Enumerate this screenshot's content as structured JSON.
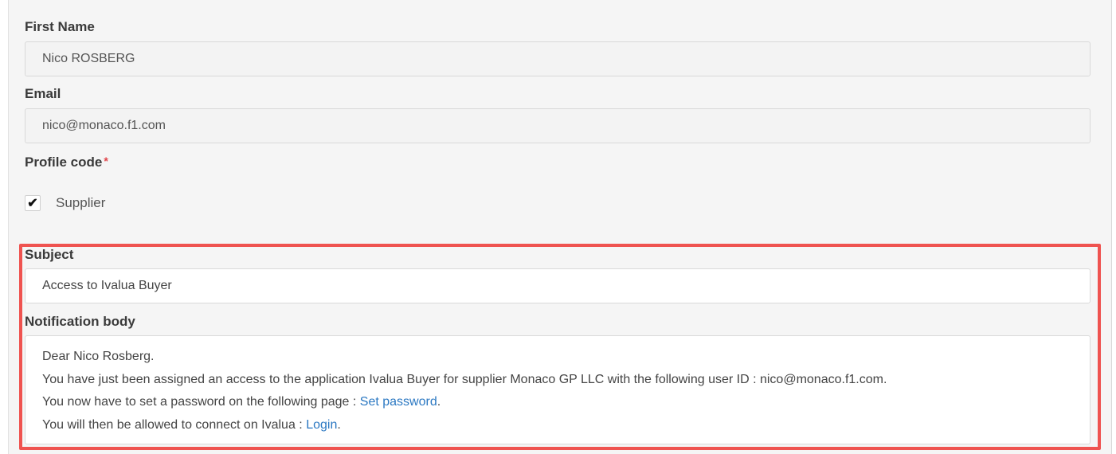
{
  "form": {
    "first_name_label": "First Name",
    "first_name_value": "Nico ROSBERG",
    "email_label": "Email",
    "email_value": "nico@monaco.f1.com",
    "profile_code_label": "Profile code",
    "required_mark": "*",
    "profile_option_label": "Supplier",
    "profile_option_checked": true,
    "check_glyph": "✔"
  },
  "notification": {
    "subject_label": "Subject",
    "subject_value": "Access to Ivalua Buyer",
    "body_label": "Notification body",
    "line1": "Dear Nico Rosberg.",
    "line2": "You have just been assigned an access to the application Ivalua Buyer for supplier Monaco GP LLC with the following user ID : nico@monaco.f1.com.",
    "line3_prefix": "You now have to set a password on the following page : ",
    "line3_link": "Set password",
    "line3_suffix": ".",
    "line4_prefix": "You will then be allowed to connect on Ivalua : ",
    "line4_link": "Login",
    "line4_suffix": "."
  },
  "colors": {
    "highlight_border": "#ef5350",
    "link": "#2b78c2",
    "required": "#e0454a"
  }
}
